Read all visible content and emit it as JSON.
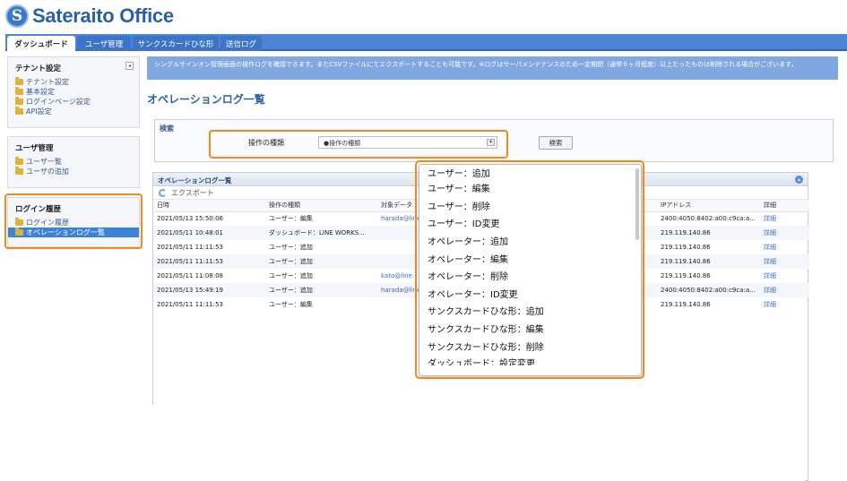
{
  "app": {
    "logo_letter": "S",
    "logo_text": "Sateraito Office",
    "brand_color": "#2a5fa8",
    "highlight_color": "#f08a1d"
  },
  "tabs": [
    {
      "label": "ダッシュボード",
      "active": true
    },
    {
      "label": "ユーザ管理"
    },
    {
      "label": "サンクスカードひな形"
    },
    {
      "label": "送信ログ"
    }
  ],
  "sidebar": {
    "tenant": {
      "title": "テナント設定",
      "items": [
        "テナント設定",
        "基本設定",
        "ログインページ設定",
        "API設定"
      ]
    },
    "user": {
      "title": "ユーザ管理",
      "items": [
        "ユーザ一覧",
        "ユーザの追加"
      ]
    },
    "login": {
      "title": "ログイン履歴",
      "items": [
        "ログイン履歴",
        "オペレーションログ一覧"
      ]
    }
  },
  "notice": "シングルサインオン管理画面の操作ログを確認できます。またCSVファイルにてエクスポートすることも可能です。※ログはサーバメンテナンスのため一定期間（通常６ヶ月程度）以上たったものは削除される場合がございます。",
  "page_title": "オペレーションログ一覧",
  "search": {
    "title": "検索",
    "op_label": "操作の種類",
    "op_value": "●操作の種類",
    "button": "検索"
  },
  "log": {
    "title": "オペレーションログ一覧",
    "export": "エクスポート",
    "columns": [
      "日時",
      "操作の種類",
      "対象データ",
      "",
      "IPアドレス",
      "詳細"
    ],
    "rows": [
      [
        "2021/05/13 15:50:06",
        "ユーザー：編集",
        "harada@line",
        "2400:4050:8402:a00:c9ca:a...",
        "詳細"
      ],
      [
        "2021/05/11 10:48:01",
        "ダッシュボード：LINE WORKS...",
        "",
        "219.119.140.86",
        "詳細"
      ],
      [
        "2021/05/11 11:11:53",
        "ユーザー：追加",
        "",
        "219.119.140.86",
        "詳細"
      ],
      [
        "2021/05/11 11:11:53",
        "ユーザー：追加",
        "",
        "219.119.140.86",
        "詳細"
      ],
      [
        "2021/05/11 11:08:08",
        "ユーザー：追加",
        "kato@line.",
        "219.119.140.86",
        "詳細"
      ],
      [
        "2021/05/13 15:49:19",
        "ユーザー：追加",
        "harada@line",
        "2400:4050:8402:a00:c9ca:a...",
        "詳細"
      ],
      [
        "2021/05/11 11:11:53",
        "ユーザー：編集",
        "",
        "219.119.140.86",
        "詳細"
      ]
    ]
  },
  "dropdown": {
    "items": [
      "ユーザー：追加",
      "ユーザー：編集",
      "ユーザー：削除",
      "ユーザー：ID変更",
      "オペレーター：追加",
      "オペレーター：編集",
      "オペレーター：削除",
      "オペレーター：ID変更",
      "サンクスカードひな形：追加",
      "サンクスカードひな形：編集",
      "サンクスカードひな形：削除",
      "ダッシュボード：設定変更"
    ]
  }
}
